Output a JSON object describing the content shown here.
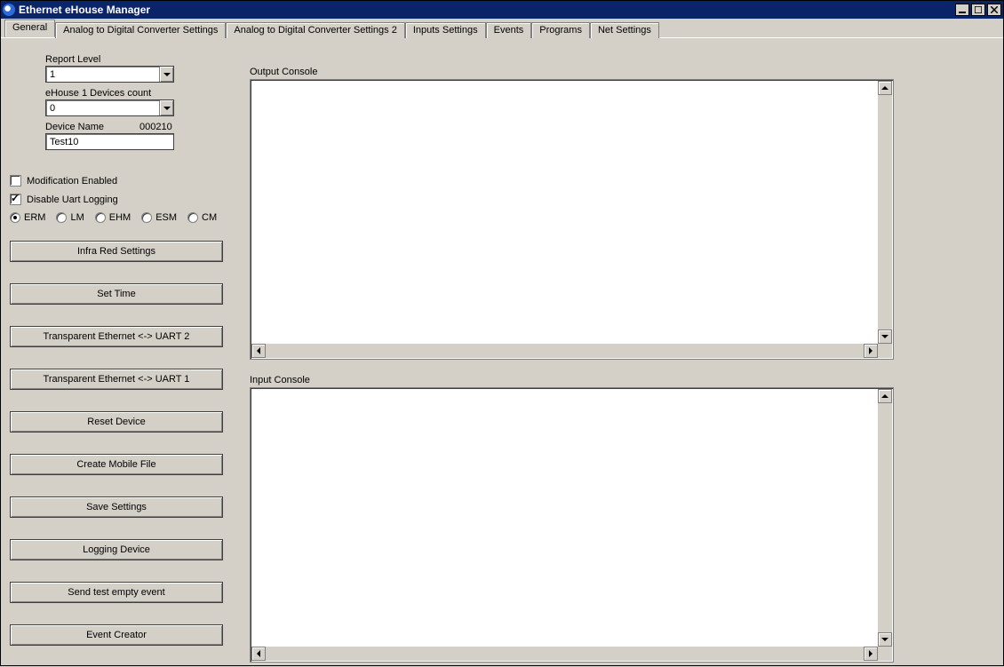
{
  "window": {
    "title": "Ethernet eHouse Manager"
  },
  "tabs": [
    {
      "label": "General",
      "active": true
    },
    {
      "label": "Analog to Digital Converter Settings",
      "active": false
    },
    {
      "label": "Analog to Digital Converter Settings 2",
      "active": false
    },
    {
      "label": "Inputs Settings",
      "active": false
    },
    {
      "label": "Events",
      "active": false
    },
    {
      "label": "Programs",
      "active": false
    },
    {
      "label": "Net Settings",
      "active": false
    }
  ],
  "form": {
    "report_level_label": "Report Level",
    "report_level_value": "1",
    "devices_count_label": "eHouse 1 Devices count",
    "devices_count_value": "0",
    "device_name_label": "Device Name",
    "device_id": "000210",
    "device_name_value": "Test10"
  },
  "checkboxes": {
    "modification": {
      "label": "Modification Enabled",
      "checked": false
    },
    "uart": {
      "label": "Disable Uart Logging",
      "checked": true
    }
  },
  "radios": {
    "selected": "ERM",
    "options": [
      "ERM",
      "LM",
      "EHM",
      "ESM",
      "CM"
    ]
  },
  "buttons": [
    "Infra Red Settings",
    "Set Time",
    "Transparent Ethernet <-> UART 2",
    "Transparent Ethernet <-> UART 1",
    "Reset Device",
    "Create Mobile File",
    "Save Settings",
    "Logging Device",
    "Send test empty event",
    "Event Creator"
  ],
  "consoles": {
    "output_label": "Output Console",
    "input_label": "Input Console"
  }
}
